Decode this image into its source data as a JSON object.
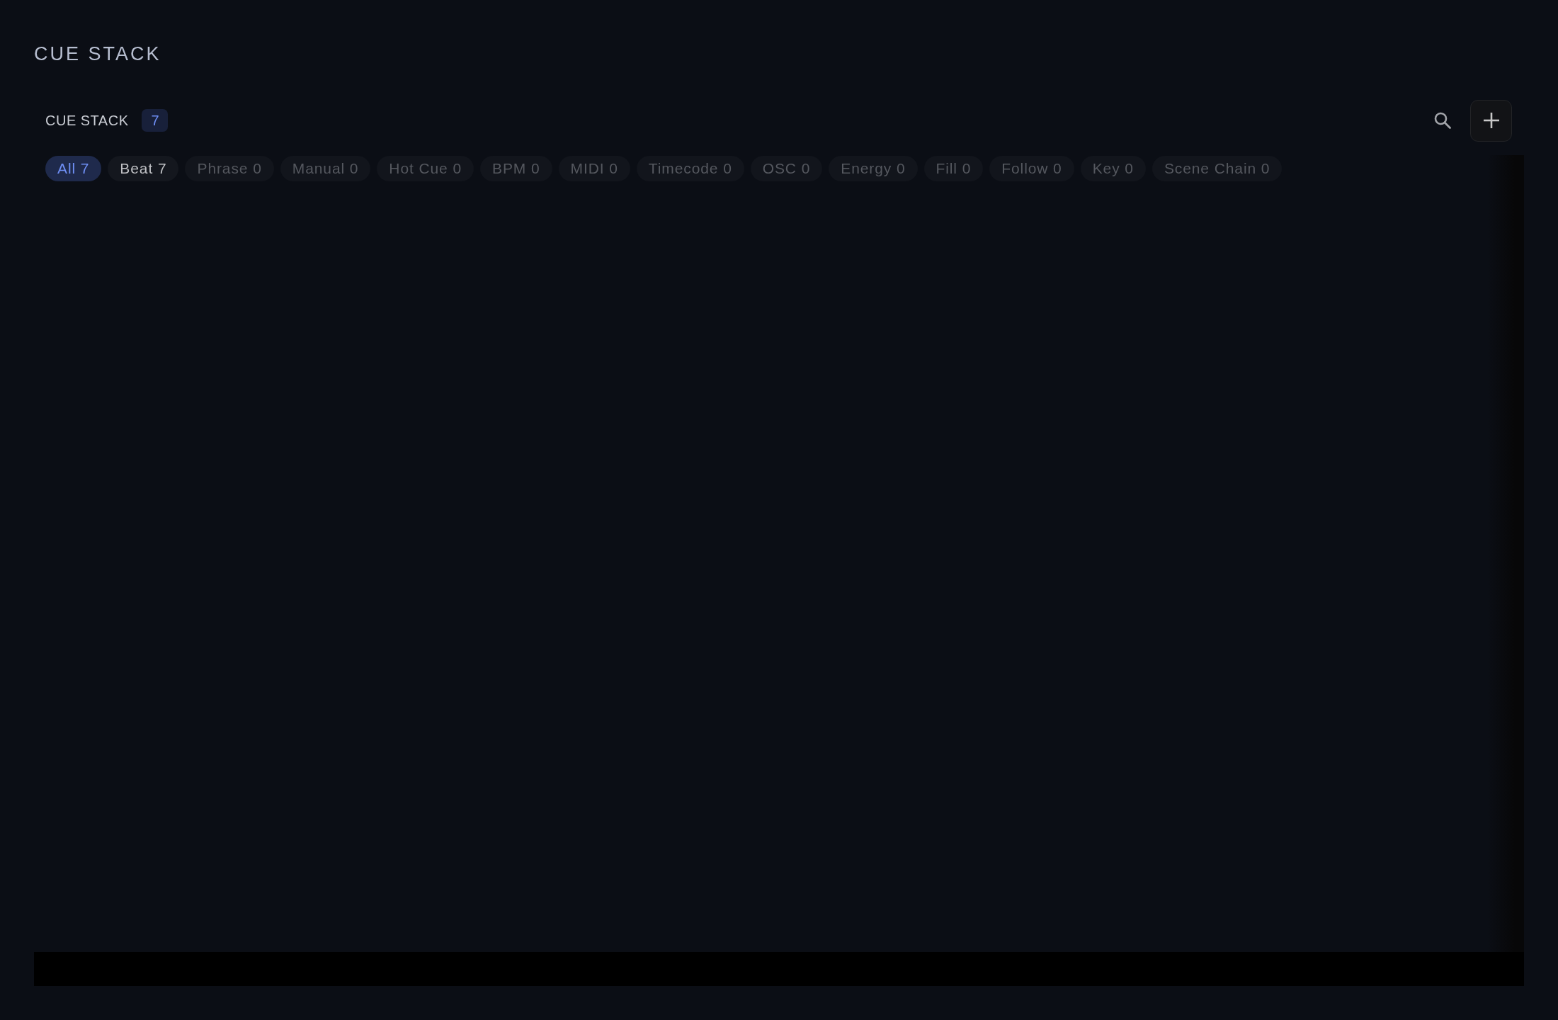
{
  "page_title": "CUE STACK",
  "header": {
    "title": "CUE STACK",
    "count": "7"
  },
  "filters": [
    {
      "label": "All 7",
      "selected": true,
      "disabled": false
    },
    {
      "label": "Beat 7",
      "selected": false,
      "disabled": false
    },
    {
      "label": "Phrase 0",
      "selected": false,
      "disabled": true
    },
    {
      "label": "Manual 0",
      "selected": false,
      "disabled": true
    },
    {
      "label": "Hot Cue 0",
      "selected": false,
      "disabled": true
    },
    {
      "label": "BPM 0",
      "selected": false,
      "disabled": true
    },
    {
      "label": "MIDI 0",
      "selected": false,
      "disabled": true
    },
    {
      "label": "Timecode 0",
      "selected": false,
      "disabled": true
    },
    {
      "label": "OSC 0",
      "selected": false,
      "disabled": true
    },
    {
      "label": "Energy 0",
      "selected": false,
      "disabled": true
    },
    {
      "label": "Fill 0",
      "selected": false,
      "disabled": true
    },
    {
      "label": "Follow 0",
      "selected": false,
      "disabled": true
    },
    {
      "label": "Key 0",
      "selected": false,
      "disabled": true
    },
    {
      "label": "Scene Chain 0",
      "selected": false,
      "disabled": true
    }
  ]
}
